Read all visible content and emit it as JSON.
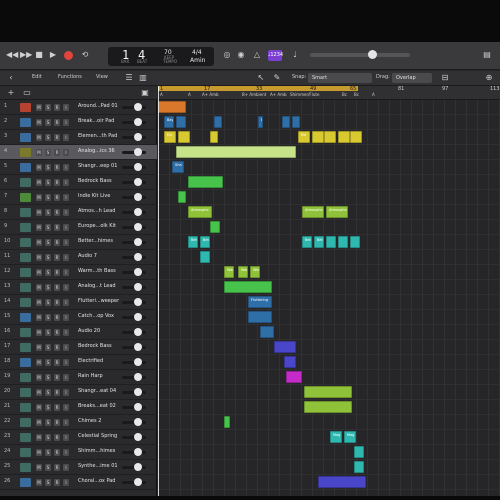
{
  "control_bar": {
    "lcd_bar": "1",
    "lcd_beat": "4",
    "lcd_bar_label": "BAR",
    "lcd_beat_label": "BEAT",
    "tempo": "70",
    "tempo_label": "KEEP",
    "tempo_sub": "TEMPO",
    "time_sig": "4/4",
    "key": "Amin",
    "count_in_badge": "♩1234"
  },
  "edit_toolbar": {
    "edit": "Edit",
    "functions": "Functions",
    "view": "View",
    "snap_label": "Snap:",
    "snap_value": "Smart",
    "drag_label": "Drag:",
    "drag_value": "Overlap"
  },
  "ruler": {
    "numbers": [
      "1",
      "17",
      "33",
      "49",
      "65",
      "81",
      "97",
      "113"
    ],
    "markers": [
      "A",
      "A",
      "A+ Amb",
      "B+ Ambient",
      "A+ Amb",
      "Shimmer/Flute",
      "Bc",
      "Bc",
      "A"
    ]
  },
  "tracks": [
    {
      "num": "1",
      "name": "Around...Pad 01"
    },
    {
      "num": "2",
      "name": "Break...oir Pad"
    },
    {
      "num": "3",
      "name": "Elemen...th Pad"
    },
    {
      "num": "4",
      "name": "Analog...ics 36"
    },
    {
      "num": "5",
      "name": "Shangr...eep 01"
    },
    {
      "num": "6",
      "name": "Bedrock Bass"
    },
    {
      "num": "7",
      "name": "Indie Kit Live"
    },
    {
      "num": "8",
      "name": "Atmos...h Lead"
    },
    {
      "num": "9",
      "name": "Europe...olk Kit"
    },
    {
      "num": "10",
      "name": "Better...himes"
    },
    {
      "num": "11",
      "name": "Audio 7"
    },
    {
      "num": "12",
      "name": "Warm...th Bass"
    },
    {
      "num": "13",
      "name": "Analog...t Lead"
    },
    {
      "num": "14",
      "name": "Flutteri...weeper"
    },
    {
      "num": "15",
      "name": "Catch...op Vox"
    },
    {
      "num": "16",
      "name": "Audio 20"
    },
    {
      "num": "17",
      "name": "Bedrock Bass"
    },
    {
      "num": "18",
      "name": "Electrified"
    },
    {
      "num": "19",
      "name": "Rain Harp"
    },
    {
      "num": "20",
      "name": "Shangr...eat 04"
    },
    {
      "num": "21",
      "name": "Breaks...eat 02"
    },
    {
      "num": "22",
      "name": "Chimes 2"
    },
    {
      "num": "23",
      "name": "Celestial Spring"
    },
    {
      "num": "24",
      "name": "Shimm...himes"
    },
    {
      "num": "25",
      "name": "Synthe...ime 01"
    },
    {
      "num": "26",
      "name": "Choral...ox Pad"
    }
  ],
  "msr": {
    "m": "M",
    "s": "S",
    "r": "R",
    "i": "I"
  },
  "regions": {
    "r1": "",
    "r2a": "Bay",
    "r2b": "B",
    "r3a": "Ele",
    "r3b": "Ele",
    "r5": "Sha",
    "r8a": "Atmosphe",
    "r8b": "Atmospheric",
    "r8c": "Atmospheric",
    "r10a": "Bett",
    "r10b": "Bett",
    "r10c": "Bett",
    "r10d": "Bett",
    "r12a": "Warm",
    "r12b": "Warm",
    "r12c": "Warm",
    "r14": "Fluttering",
    "r23a": "Mag",
    "r23b": "Mag"
  },
  "colors": {
    "orange": "#d9782a",
    "blue": "#2f6fa8",
    "yellow": "#d8c930",
    "lightgreen": "#c7e38a",
    "green": "#47c24a",
    "teal": "#2fb8b0",
    "purple": "#4a46c9",
    "magenta": "#c42bc9",
    "olive": "#8fc238"
  }
}
